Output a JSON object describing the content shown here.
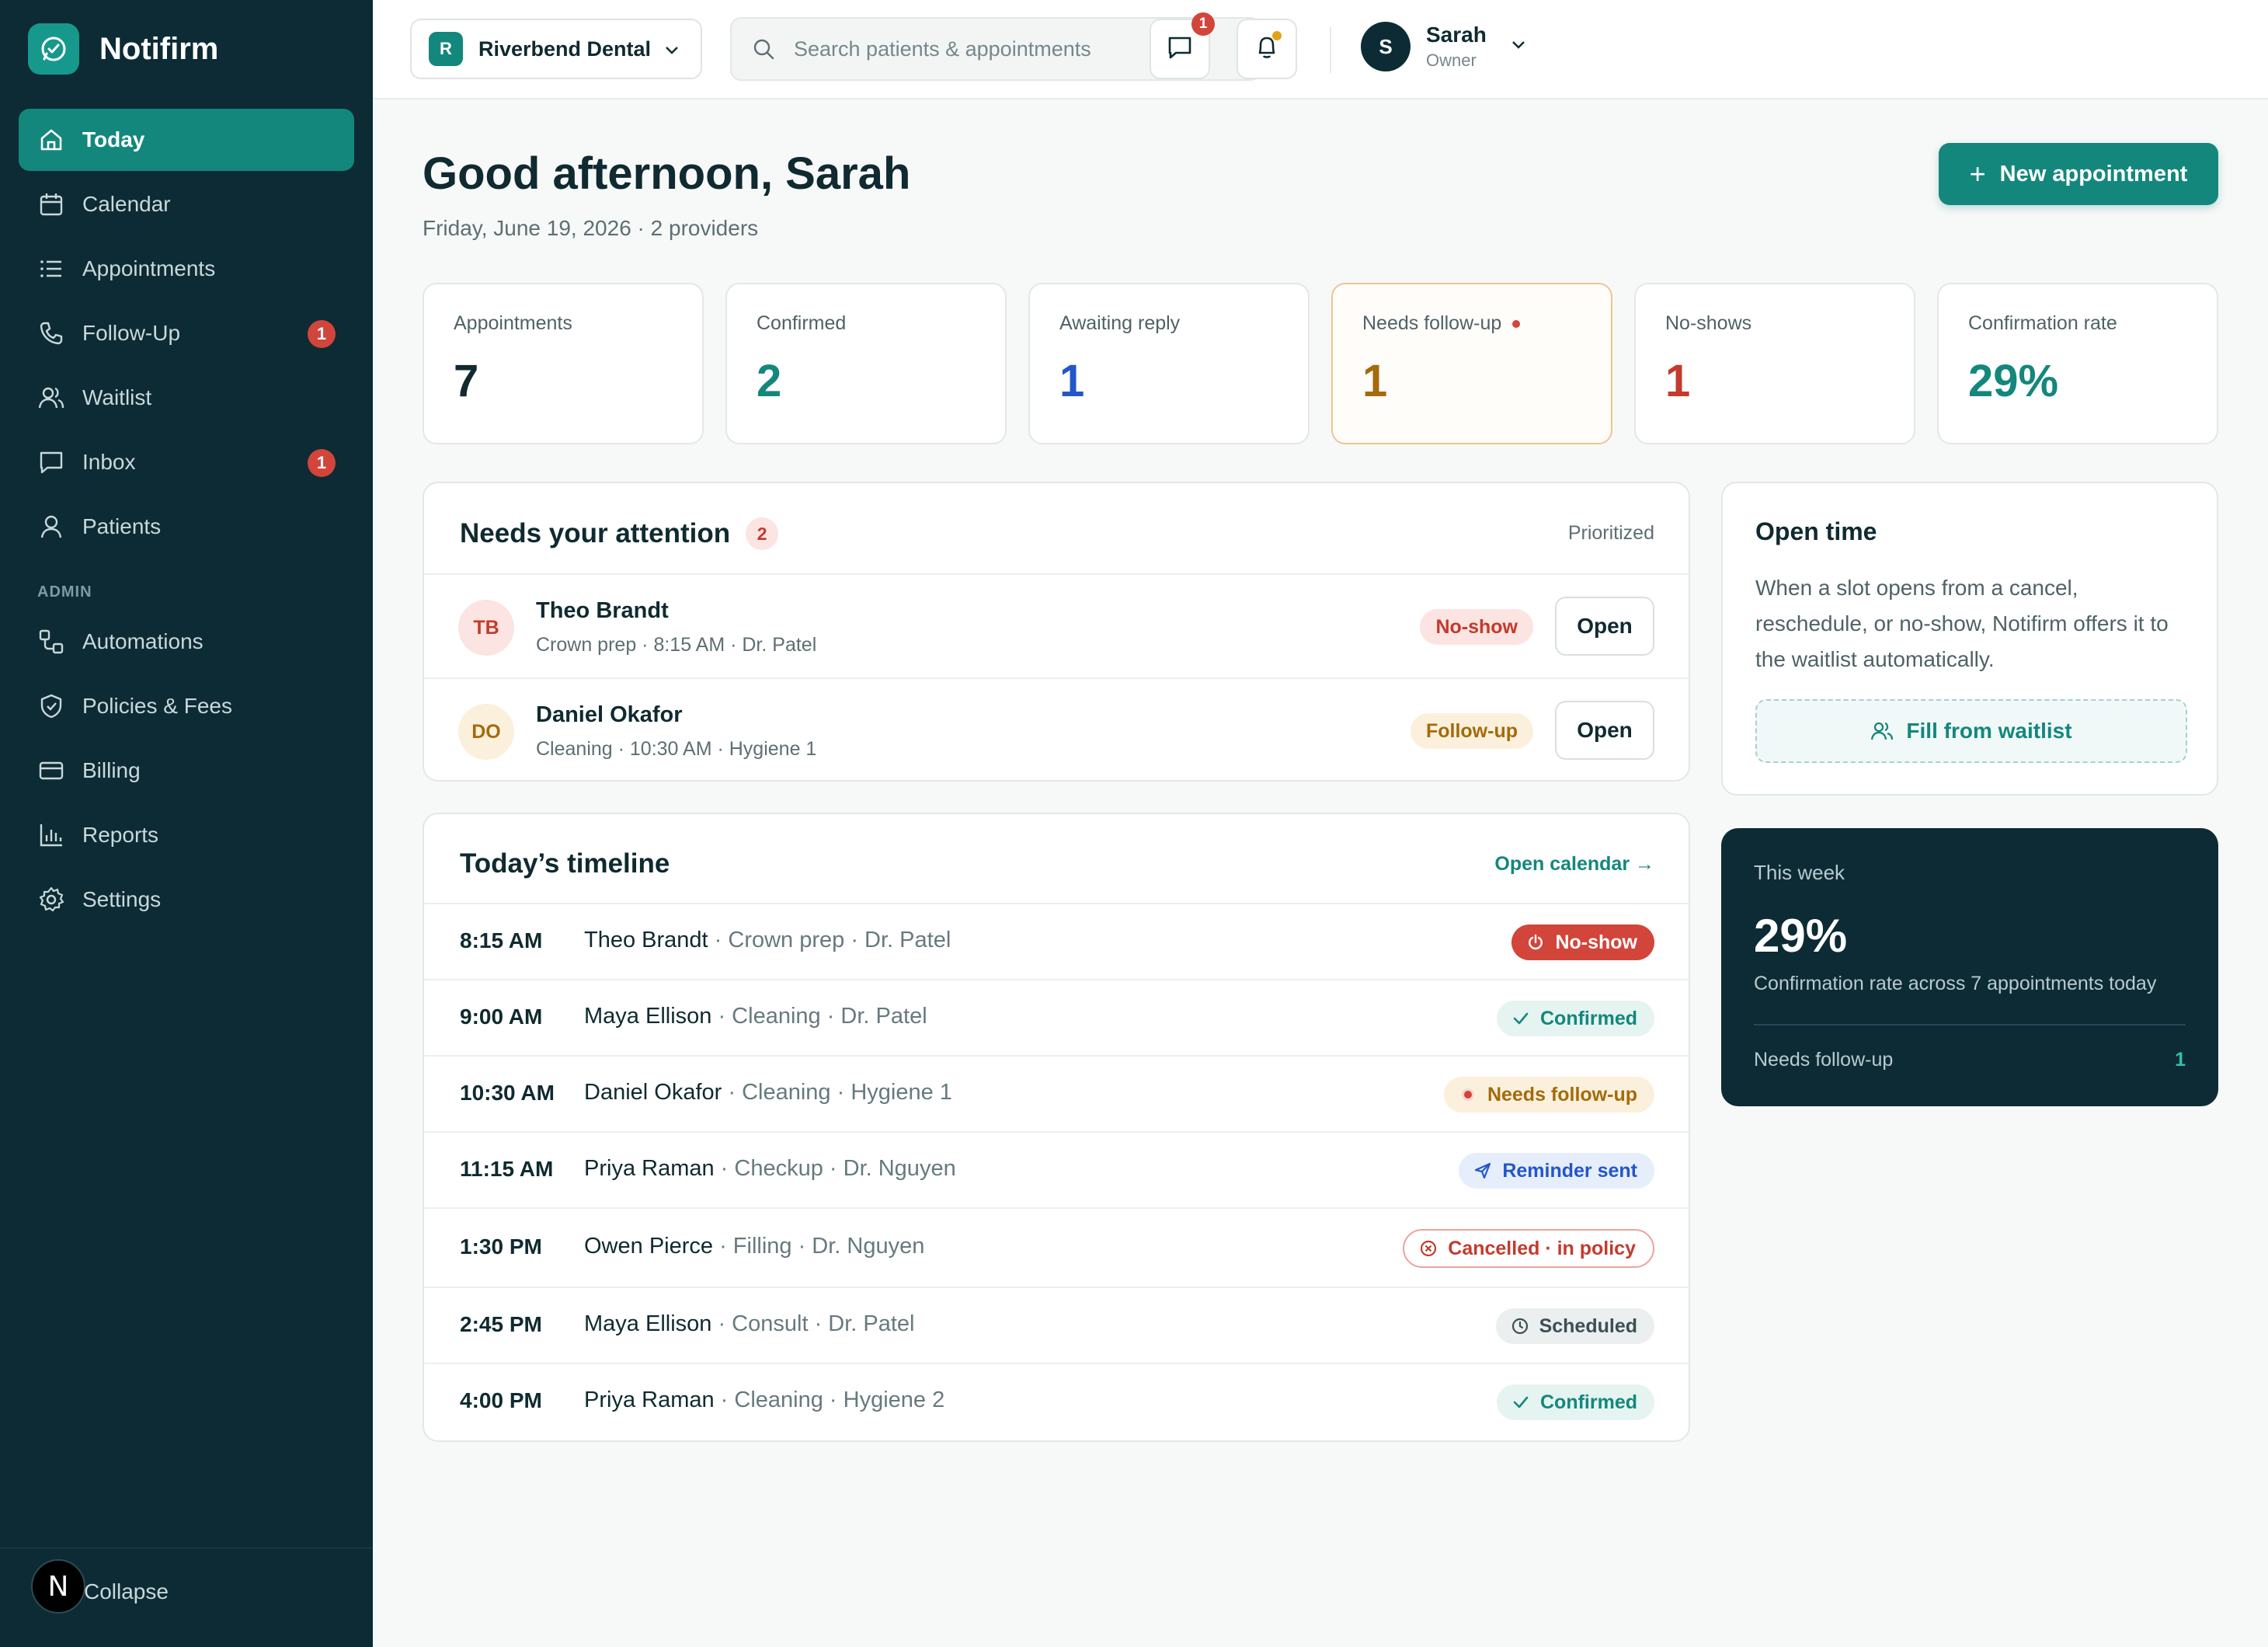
{
  "app": {
    "name": "Notifirm"
  },
  "sidebar": {
    "items": [
      {
        "label": "Today",
        "icon": "home-icon",
        "active": true
      },
      {
        "label": "Calendar",
        "icon": "calendar-icon"
      },
      {
        "label": "Appointments",
        "icon": "list-icon"
      },
      {
        "label": "Follow-Up",
        "icon": "phone-icon",
        "badge": "1"
      },
      {
        "label": "Waitlist",
        "icon": "users-icon"
      },
      {
        "label": "Inbox",
        "icon": "inbox-icon",
        "badge": "1"
      },
      {
        "label": "Patients",
        "icon": "user-icon"
      }
    ],
    "admin_label": "ADMIN",
    "admin_items": [
      {
        "label": "Automations",
        "icon": "workflow-icon"
      },
      {
        "label": "Policies & Fees",
        "icon": "shield-icon"
      },
      {
        "label": "Billing",
        "icon": "credit-card-icon"
      },
      {
        "label": "Reports",
        "icon": "bar-chart-icon"
      },
      {
        "label": "Settings",
        "icon": "gear-icon"
      }
    ],
    "footer": {
      "avatar_letter": "N",
      "collapse_label": "Collapse"
    }
  },
  "topbar": {
    "practice": {
      "initial": "R",
      "name": "Riverbend Dental"
    },
    "search_placeholder": "Search patients & appointments",
    "messages_badge": "1",
    "user": {
      "initial": "S",
      "name": "Sarah",
      "role": "Owner"
    }
  },
  "header": {
    "greeting": "Good afternoon, Sarah",
    "subtitle": "Friday, June 19, 2026 · 2 providers",
    "new_appointment_label": "New appointment"
  },
  "stats": [
    {
      "label": "Appointments",
      "value": "7",
      "color": "#0f2a30"
    },
    {
      "label": "Confirmed",
      "value": "2",
      "color": "#14877d"
    },
    {
      "label": "Awaiting reply",
      "value": "1",
      "color": "#2456c9"
    },
    {
      "label": "Needs follow-up",
      "value": "1",
      "color": "#a36b0b",
      "alert": true
    },
    {
      "label": "No-shows",
      "value": "1",
      "color": "#c23b2e"
    },
    {
      "label": "Confirmation rate",
      "value": "29%",
      "color": "#14877d"
    }
  ],
  "attention": {
    "title": "Needs your attention",
    "count": "2",
    "sort_label": "Prioritized",
    "rows": [
      {
        "initials": "TB",
        "name": "Theo Brandt",
        "detail": "Crown prep · 8:15 AM · Dr. Patel",
        "tag": "No-show",
        "action": "Open"
      },
      {
        "initials": "DO",
        "name": "Daniel Okafor",
        "detail": "Cleaning · 10:30 AM · Hygiene 1",
        "tag": "Follow-up",
        "action": "Open"
      }
    ]
  },
  "timeline": {
    "title": "Today’s timeline",
    "link_label": "Open calendar →",
    "rows": [
      {
        "time": "8:15 AM",
        "patient": "Theo Brandt",
        "detail": " · Crown prep · Dr. Patel",
        "status": "No-show",
        "status_icon": "power-icon"
      },
      {
        "time": "9:00 AM",
        "patient": "Maya Ellison",
        "detail": " · Cleaning · Dr. Patel",
        "status": "Confirmed",
        "status_icon": "check-icon"
      },
      {
        "time": "10:30 AM",
        "patient": "Daniel Okafor",
        "detail": " · Cleaning · Hygiene 1",
        "status": "Needs follow-up",
        "status_icon": "dot-icon"
      },
      {
        "time": "11:15 AM",
        "patient": "Priya Raman",
        "detail": " · Checkup · Dr. Nguyen",
        "status": "Reminder sent",
        "status_icon": "send-icon"
      },
      {
        "time": "1:30 PM",
        "patient": "Owen Pierce",
        "detail": " · Filling · Dr. Nguyen",
        "status": "Cancelled · in policy",
        "status_icon": "x-circle-icon"
      },
      {
        "time": "2:45 PM",
        "patient": "Maya Ellison",
        "detail": " · Consult · Dr. Patel",
        "status": "Scheduled",
        "status_icon": "clock-icon"
      },
      {
        "time": "4:00 PM",
        "patient": "Priya Raman",
        "detail": " · Cleaning · Hygiene 2",
        "status": "Confirmed",
        "status_icon": "check-icon"
      }
    ]
  },
  "open_time": {
    "title": "Open time",
    "body": "When a slot opens from a cancel, reschedule, or no-show, Notifirm offers it to the waitlist automatically.",
    "button_label": "Fill from waitlist"
  },
  "this_week": {
    "label": "This week",
    "value": "29%",
    "subtitle": "Confirmation rate across 7 appointments today",
    "footer_label": "Needs follow-up",
    "footer_value": "1"
  },
  "colors": {
    "sidebar_bg": "#0d2b35",
    "accent": "#14877d",
    "danger": "#c23b2e",
    "warning": "#a36b0b",
    "info": "#2456c9"
  }
}
